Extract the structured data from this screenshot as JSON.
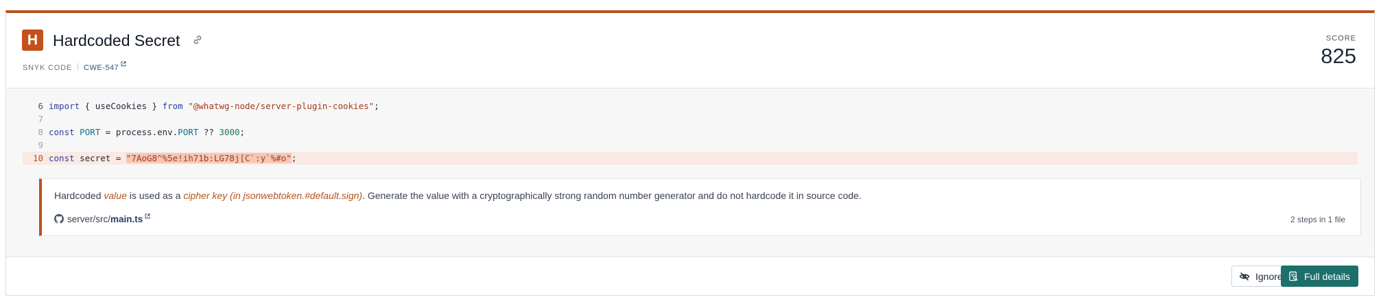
{
  "issue": {
    "severity_letter": "H",
    "title": "Hardcoded Secret",
    "source_tool": "SNYK CODE",
    "cwe": "CWE-547",
    "score_label": "SCORE",
    "score": "825",
    "severity_color": "#c4501b",
    "accent_color": "#b5521e"
  },
  "code": {
    "lines": [
      {
        "num": "6",
        "tokens": {
          "kw1": "import",
          "t1": " { useCookies } ",
          "kw2": "from",
          "t2": " ",
          "str": "\"@whatwg-node/server-plugin-cookies\"",
          "t3": ";"
        }
      },
      {
        "num": "7"
      },
      {
        "num": "8",
        "tokens": {
          "kw1": "const",
          "t1": " ",
          "var1": "PORT",
          "t2": " = process.env.",
          "var2": "PORT",
          "t3": " ?? ",
          "num": "3000",
          "t4": ";"
        }
      },
      {
        "num": "9"
      },
      {
        "num": "10",
        "tokens": {
          "kw1": "const",
          "t1": " secret = ",
          "secret": "\"7AoG8^%5e!ih71b:LG78j[C`:y`%#o\"",
          "t2": ";"
        }
      }
    ]
  },
  "finding": {
    "msg_prefix": "Hardcoded ",
    "msg_value": "value",
    "msg_mid": " is used as a ",
    "msg_sink": "cipher key (in jsonwebtoken.#default.sign)",
    "msg_suffix": ". Generate the value with a cryptographically strong random number generator and do not hardcode it in source code.",
    "path_prefix": "server/src/",
    "path_file": "main.ts",
    "steps": "2 steps in 1 file"
  },
  "actions": {
    "ignore_label": "Ignore",
    "full_details_label": "Full details",
    "primary_color": "#1c6f6b"
  },
  "icons": [
    "link-icon",
    "external-link-icon",
    "github-icon",
    "eye-off-icon",
    "details-icon"
  ]
}
